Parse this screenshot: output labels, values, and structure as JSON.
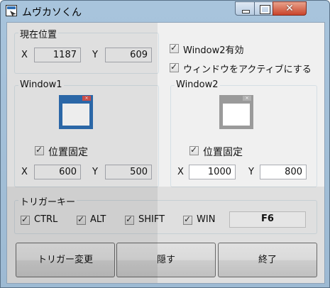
{
  "window": {
    "title": "ムヴカソくん",
    "close_glyph": "✕"
  },
  "current_position": {
    "label": "現在位置",
    "x_label": "X",
    "x_value": "1187",
    "y_label": "Y",
    "y_value": "609"
  },
  "options": [
    {
      "label": "Window2有効",
      "checked": true
    },
    {
      "label": "ウィンドウをアクティブにする",
      "checked": true
    }
  ],
  "window1": {
    "label": "Window1",
    "fixed_label": "位置固定",
    "fixed": true,
    "x_label": "X",
    "x_value": "600",
    "y_label": "Y",
    "y_value": "500",
    "icon_color": "#2f6fb4",
    "icon_close": "×"
  },
  "window2": {
    "label": "Window2",
    "fixed_label": "位置固定",
    "fixed": true,
    "x_label": "X",
    "x_value": "1000",
    "y_label": "Y",
    "y_value": "800",
    "icon_color": "#9a9a9a",
    "icon_close": "×"
  },
  "trigger_key": {
    "label": "トリガーキー",
    "modifiers": [
      {
        "label": "CTRL",
        "checked": true
      },
      {
        "label": "ALT",
        "checked": true
      },
      {
        "label": "SHIFT",
        "checked": true
      },
      {
        "label": "WIN",
        "checked": true
      }
    ],
    "key": "F6"
  },
  "buttons": {
    "change_trigger": "トリガー変更",
    "hide": "隠す",
    "exit": "終了"
  }
}
